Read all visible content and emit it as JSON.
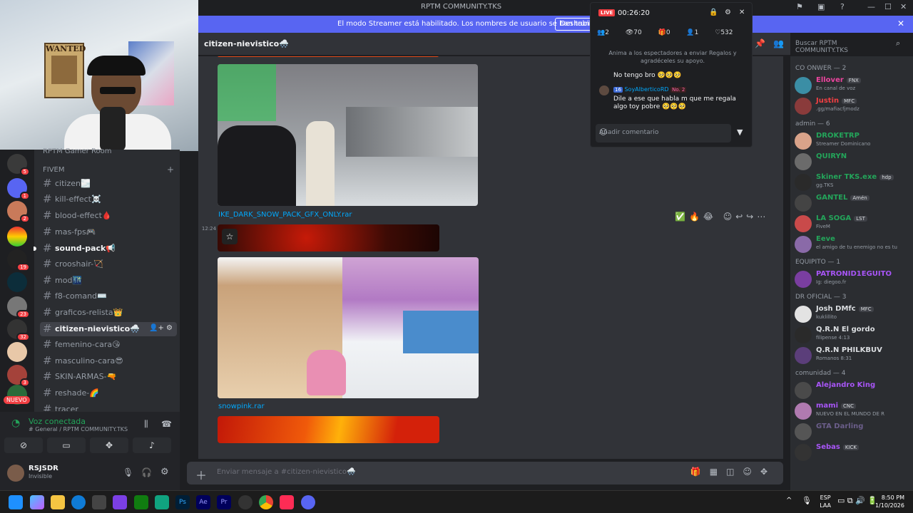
{
  "window": {
    "title": "RPTM COMMUNITY.TKS"
  },
  "banner": {
    "text": "El modo Streamer está habilitado. Los nombres de usuario se han truncado.",
    "button": "Deshabilitar"
  },
  "channel_header": {
    "name": "citizen-nievistico",
    "emoji": "🌨️"
  },
  "search": {
    "placeholder": "Buscar RPTM COMMUNITY.TKS"
  },
  "server": {
    "category_top": "RPTM Gamer Room",
    "category": "FIVEM",
    "channels": [
      {
        "name": "citizen🌫️",
        "state": "normal"
      },
      {
        "name": "kill-effect☠️",
        "state": "normal"
      },
      {
        "name": "blood-effect🩸",
        "state": "normal"
      },
      {
        "name": "mas-fps🎮",
        "state": "normal"
      },
      {
        "name": "sound-pack📢",
        "state": "unread"
      },
      {
        "name": "crooshair-🏹",
        "state": "normal"
      },
      {
        "name": "mod🌃",
        "state": "normal"
      },
      {
        "name": "f8-comand⌨️",
        "state": "normal"
      },
      {
        "name": "graficos-relista👑",
        "state": "normal"
      },
      {
        "name": "citizen-nievistico🌨️",
        "state": "active"
      },
      {
        "name": "femenino-cara😘",
        "state": "normal"
      },
      {
        "name": "masculino-cara😎",
        "state": "normal"
      },
      {
        "name": "SKIN-ARMAS-🔫",
        "state": "normal"
      },
      {
        "name": "reshade-🌈",
        "state": "normal"
      },
      {
        "name": "tracer",
        "state": "normal"
      }
    ]
  },
  "rail": {
    "badges": [
      "5",
      "1",
      "2",
      "19",
      "23",
      "32",
      "3"
    ],
    "nuevo": "NUEVO"
  },
  "voice": {
    "status": "Voz conectada",
    "channel": "# General / RPTM COMMUNITY.TKS"
  },
  "user": {
    "name": "RSJSDR",
    "status": "Invisible"
  },
  "chat": {
    "attachments": [
      "IKE_DARK_SNOW_PACK_GFX_ONLY.rar",
      "snowpink.rar"
    ],
    "timestamp": "12:24",
    "composer_placeholder": "Enviar mensaje a #citizen-nievistico🌨️"
  },
  "live": {
    "badge": "LIVE",
    "time": "00:26:20",
    "stats": [
      "2",
      "70",
      "0",
      "1",
      "532"
    ],
    "hint": "Anima a los espectadores a enviar Regalos y agradéceles su apoyo.",
    "messages": [
      {
        "text": "No tengo bro 🥺🥺🥺"
      },
      {
        "user": "SoyAlberticoRD",
        "level": "16",
        "rank": "No. 2",
        "text": "Dile a ese que habla m que me regala algo toy pobre 🥺🥺🥺"
      }
    ],
    "input_placeholder": "Añadir comentario"
  },
  "members": {
    "groups": [
      {
        "label": "CO ONWER — 2",
        "members": [
          {
            "name": "Ellover",
            "tag": "FNX",
            "status": "En canal de voz",
            "color": "#eb459e"
          },
          {
            "name": "Justin",
            "tag": "MFC",
            "status": ".gg/mafiacfjmodz",
            "color": "#f23f43"
          }
        ]
      },
      {
        "label": "admin — 6",
        "members": [
          {
            "name": "DROKETRP",
            "tag": "",
            "status": "Streamer Dominicano",
            "color": "#23a55a"
          },
          {
            "name": "QUIRYN",
            "tag": "",
            "status": "",
            "color": "#23a55a"
          },
          {
            "name": "Skiner TKS.exe",
            "tag": "hdp",
            "status": "gg.TKS",
            "color": "#23a55a"
          },
          {
            "name": "GANTEL",
            "tag": "Amén",
            "status": "",
            "color": "#23a55a"
          },
          {
            "name": "LA SOGA",
            "tag": "LST",
            "status": "FiveM",
            "color": "#23a55a"
          },
          {
            "name": "Eeve",
            "tag": "",
            "status": "el amigo de tu enemigo no es tu",
            "color": "#23a55a"
          }
        ]
      },
      {
        "label": "EQUIPITO — 1",
        "members": [
          {
            "name": "PATRONID1EGUITO",
            "tag": "",
            "status": "Ig: diegoo.fr",
            "color": "#a855f7"
          }
        ]
      },
      {
        "label": "DR OFICIAL — 3",
        "members": [
          {
            "name": "Josh DMfc",
            "tag": "MFC",
            "status": "kuklillito",
            "color": "#dbdee1"
          },
          {
            "name": "Q.R.N El gordo",
            "tag": "",
            "status": "filipense 4:13",
            "color": "#dbdee1"
          },
          {
            "name": "Q.R.N PHILKBUV",
            "tag": "",
            "status": "Romanos 8:31",
            "color": "#dbdee1"
          }
        ]
      },
      {
        "label": "comunidad — 4",
        "members": [
          {
            "name": "Alejandro King",
            "tag": "",
            "status": "",
            "color": "#a855f7"
          },
          {
            "name": "mami",
            "tag": "CNC",
            "status": "NUEVO EN EL MUNDO DE R",
            "color": "#a855f7"
          },
          {
            "name": "GTA Darling",
            "tag": "",
            "status": "",
            "color": "#6b5e8a"
          },
          {
            "name": "Sebas",
            "tag": "KICK",
            "status": "",
            "color": "#a855f7"
          }
        ]
      }
    ]
  },
  "taskbar": {
    "lang": "ESP",
    "lang2": "LAA",
    "time": "8:50 PM",
    "date": "1/10/2026"
  }
}
